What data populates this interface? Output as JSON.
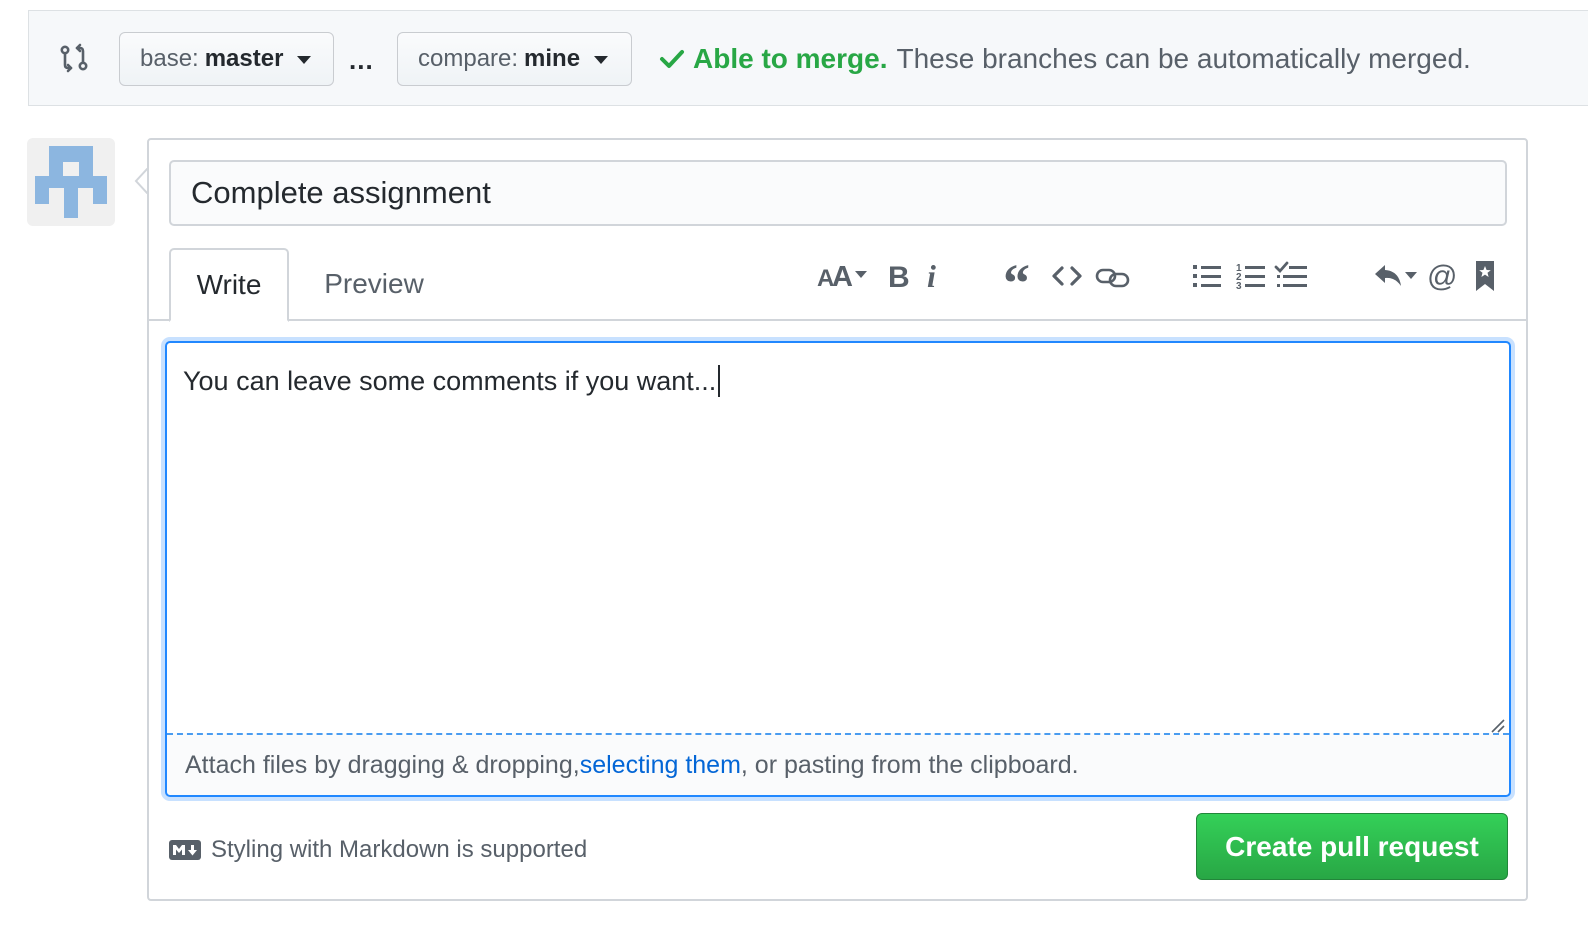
{
  "compare_bar": {
    "base_prefix": "base:",
    "base_branch": "master",
    "separator": "...",
    "compare_prefix": "compare:",
    "compare_branch": "mine",
    "merge_ok": "Able to merge.",
    "merge_message": "These branches can be automatically merged."
  },
  "form": {
    "title_value": "Complete assignment",
    "tabs": [
      {
        "label": "Write"
      },
      {
        "label": "Preview"
      }
    ],
    "toolbar_icons": [
      "text-size-icon",
      "bold-icon",
      "italic-icon",
      "quote-icon",
      "code-icon",
      "link-icon",
      "unordered-list-icon",
      "ordered-list-icon",
      "task-list-icon",
      "reply-icon",
      "mention-icon",
      "saved-reply-icon"
    ],
    "body_value": "You can leave some comments if you want...",
    "attach": {
      "prefix": "Attach files by dragging & dropping, ",
      "link": "selecting them",
      "suffix": ", or pasting from the clipboard."
    },
    "markdown_note": "Styling with Markdown is supported",
    "submit_label": "Create pull request"
  },
  "colors": {
    "accent_green": "#28a745",
    "link_blue": "#0366d6",
    "focus_blue": "#2188ff"
  }
}
